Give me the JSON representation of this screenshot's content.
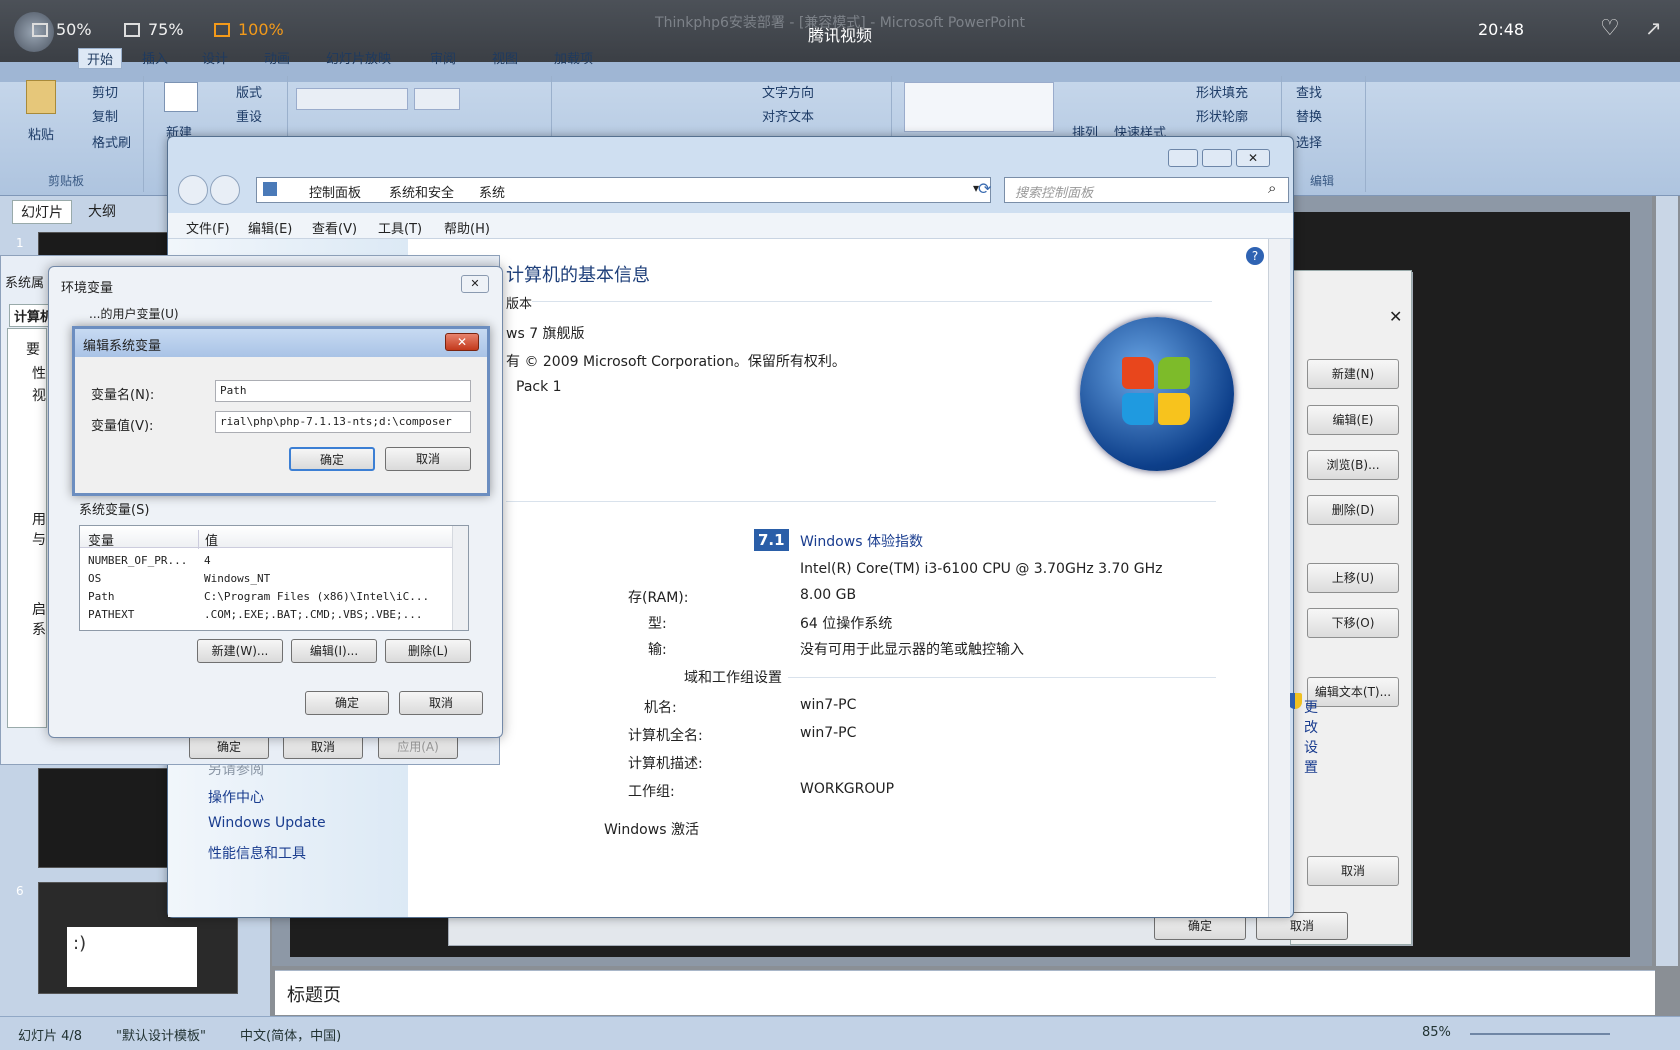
{
  "video": {
    "zoom_options": [
      "50%",
      "75%",
      "100%"
    ],
    "title": "腾讯视频",
    "behind_title": "Thinkphp6安装部署 - [兼容模式] - Microsoft PowerPoint",
    "clock": "20:48"
  },
  "ppt": {
    "tabs": [
      "开始",
      "插入",
      "设计",
      "动画",
      "幻灯片放映",
      "审阅",
      "视图",
      "加载项"
    ],
    "clipboard": {
      "paste": "粘贴",
      "cut": "剪切",
      "copy": "复制",
      "format_painter": "格式刷",
      "label": "剪贴板"
    },
    "slides": {
      "new_slide": "新建",
      "layout": "版式",
      "reset": "重设"
    },
    "paragraph": {
      "text_direction": "文字方向",
      "align_text": "对齐文本"
    },
    "drawing": {
      "arrange": "排列",
      "quick_styles": "快速样式",
      "shape_fill": "形状填充",
      "shape_outline": "形状轮廓"
    },
    "editing": {
      "find": "查找",
      "replace": "替换",
      "select": "选择",
      "label": "编辑"
    },
    "pane_tabs": [
      "幻灯片",
      "大纲"
    ],
    "slide_numbers": [
      "1",
      "6"
    ],
    "thumb_text": ":)",
    "notes_placeholder": "标题页",
    "status": {
      "slide": "幻灯片 4/8",
      "theme": "\"默认设计模板\"",
      "lang": "中文(简体，中国)",
      "zoom": "85%"
    }
  },
  "right_dialog": {
    "buttons": [
      "新建(N)",
      "编辑(E)",
      "浏览(B)...",
      "删除(D)",
      "上移(U)",
      "下移(O)",
      "编辑文本(T)...",
      "取消"
    ],
    "bottom_ok": "确定",
    "bottom_cancel": "取消"
  },
  "control_panel": {
    "breadcrumb": [
      "控制面板",
      "系统和安全",
      "系统"
    ],
    "search_placeholder": "搜索控制面板",
    "menu": [
      "文件(F)",
      "编辑(E)",
      "查看(V)",
      "工具(T)",
      "帮助(H)"
    ],
    "heading": "计算机的基本信息",
    "edition_label": "版本",
    "edition": "ws 7 旗舰版",
    "copyright": "有 © 2009 Microsoft Corporation。保留所有权利。",
    "sp": "Pack 1",
    "wei_score": "7.1",
    "wei_link": "Windows 体验指数",
    "processor": "Intel(R) Core(TM) i3-6100 CPU @ 3.70GHz   3.70 GHz",
    "ram_label": "存(RAM):",
    "ram": "8.00 GB",
    "systype_label": "型:",
    "systype": "64 位操作系统",
    "pen_label": "输:",
    "pen": "没有可用于此显示器的笔或触控输入",
    "domain_section": "域和工作组设置",
    "computer_name_label": "机名:",
    "computer_name": "win7-PC",
    "full_name_label": "计算机全名:",
    "full_name": "win7-PC",
    "desc_label": "计算机描述:",
    "workgroup_label": "工作组:",
    "workgroup": "WORKGROUP",
    "change_settings": "更改设置",
    "activation": "Windows 激活",
    "see_also": "另请参阅",
    "nav_links": [
      "操作中心",
      "Windows Update",
      "性能信息和工具"
    ]
  },
  "sysprop": {
    "title": "系统属",
    "tab": "计算机",
    "left_chars": [
      "要",
      "性",
      "视",
      "用",
      "与",
      "启",
      "系"
    ],
    "ok": "确定",
    "cancel": "取消",
    "apply": "应用(A)"
  },
  "env_dialog": {
    "title": "环境变量",
    "user_vars_label": "...的用户变量(U)",
    "sys_vars_label": "系统变量(S)",
    "col_var": "变量",
    "col_val": "值",
    "rows": [
      {
        "name": "NUMBER_OF_PR...",
        "value": "4"
      },
      {
        "name": "OS",
        "value": "Windows_NT"
      },
      {
        "name": "Path",
        "value": "C:\\Program Files (x86)\\Intel\\iC..."
      },
      {
        "name": "PATHEXT",
        "value": ".COM;.EXE;.BAT;.CMD;.VBS;.VBE;..."
      }
    ],
    "new": "新建(W)...",
    "edit": "编辑(I)...",
    "delete": "删除(L)",
    "ok": "确定",
    "cancel": "取消"
  },
  "edit_dialog": {
    "title": "编辑系统变量",
    "name_label": "变量名(N):",
    "name_value": "Path",
    "value_label": "变量值(V):",
    "value_value": "rial\\php\\php-7.1.13-nts;d:\\composer",
    "ok": "确定",
    "cancel": "取消"
  }
}
